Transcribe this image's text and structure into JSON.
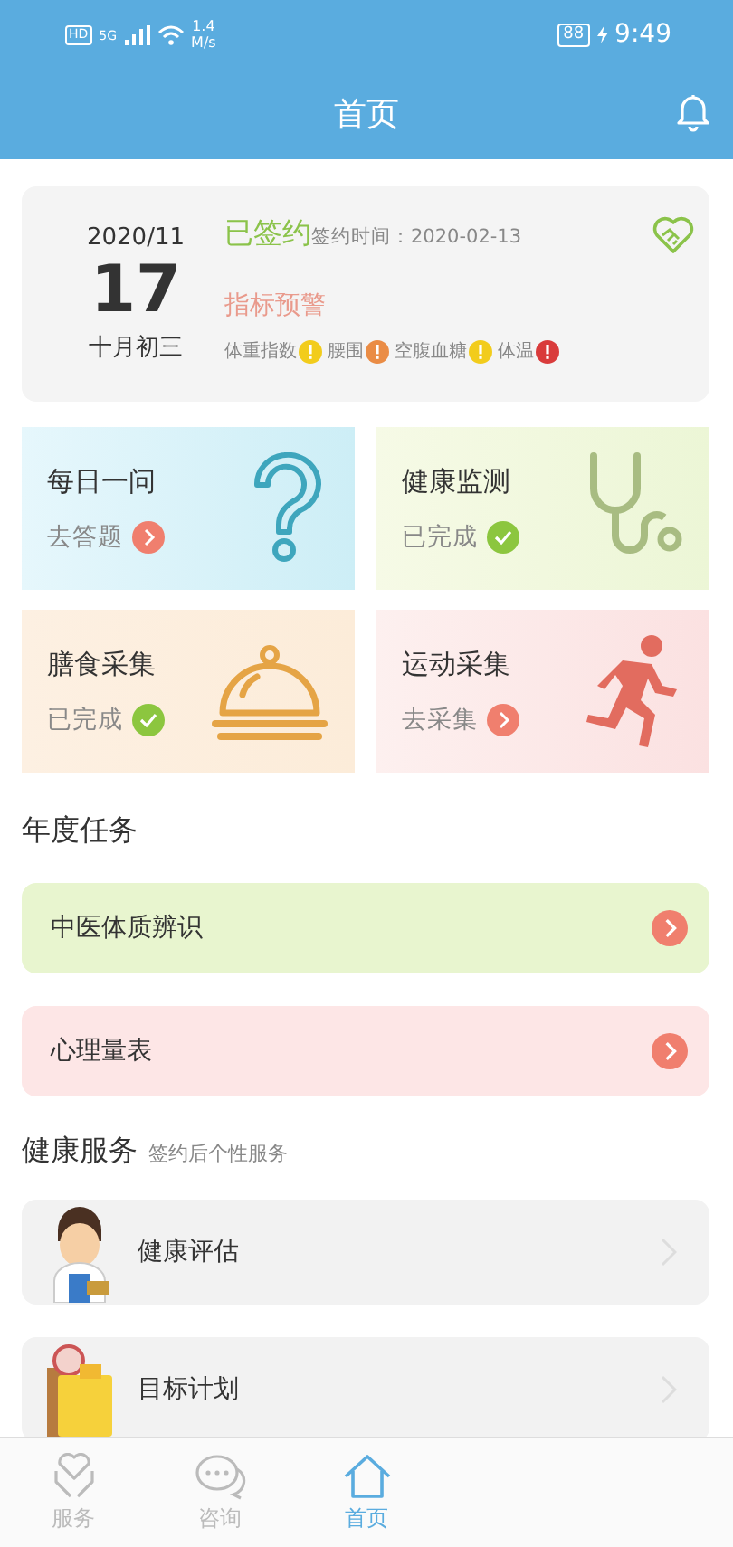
{
  "status_bar": {
    "hd": "HD",
    "network": "5G",
    "speed_value": "1.4",
    "speed_unit": "M/s",
    "battery": "88",
    "time": "9:49"
  },
  "header": {
    "title": "首页"
  },
  "sign_card": {
    "date_month": "2020/11",
    "date_day": "17",
    "lunar_date": "十月初三",
    "sign_status": "已签约",
    "sign_time": "签约时间：2020-02-13",
    "warning_title": "指标预警",
    "indicators": [
      {
        "label": "体重指数",
        "color": "#f2cc1c"
      },
      {
        "label": "腰围",
        "color": "#ea8c45"
      },
      {
        "label": "空腹血糖",
        "color": "#f2cc1c"
      },
      {
        "label": "体温",
        "color": "#d93b3b"
      }
    ]
  },
  "feature_cards": [
    {
      "title": "每日一问",
      "status": "去答题",
      "kind": "todo"
    },
    {
      "title": "健康监测",
      "status": "已完成",
      "kind": "done"
    },
    {
      "title": "膳食采集",
      "status": "已完成",
      "kind": "done"
    },
    {
      "title": "运动采集",
      "status": "去采集",
      "kind": "todo"
    }
  ],
  "annual_tasks": {
    "title": "年度任务",
    "items": [
      {
        "label": "中医体质辨识"
      },
      {
        "label": "心理量表"
      }
    ]
  },
  "health_services": {
    "title": "健康服务",
    "subtitle": "签约后个性服务",
    "items": [
      {
        "label": "健康评估"
      },
      {
        "label": "目标计划"
      }
    ]
  },
  "bottom_nav": [
    {
      "label": "服务",
      "selected": false
    },
    {
      "label": "咨询",
      "selected": false
    },
    {
      "label": "首页",
      "selected": true
    }
  ]
}
